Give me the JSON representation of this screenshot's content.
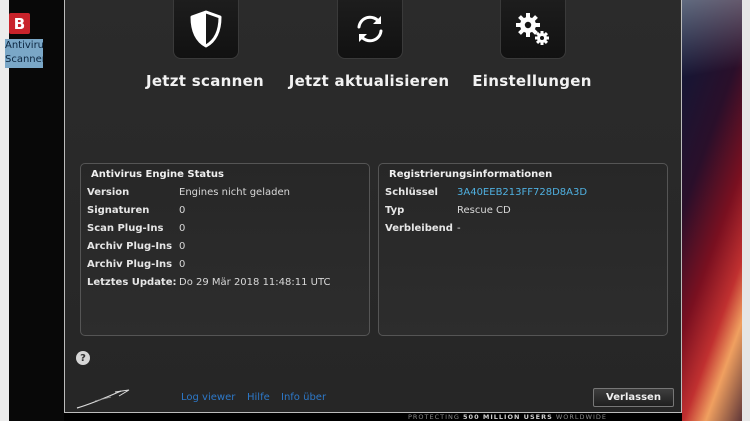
{
  "desktop": {
    "icon_letter": "B",
    "icon_label": "Antivirus Scanner"
  },
  "actions": [
    {
      "label": "Jetzt scannen",
      "icon": "shield-icon"
    },
    {
      "label": "Jetzt aktualisieren",
      "icon": "refresh-icon"
    },
    {
      "label": "Einstellungen",
      "icon": "gears-icon"
    }
  ],
  "engine_status": {
    "title": "Antivirus Engine Status",
    "rows": [
      {
        "key": "Version",
        "value": "Engines nicht geladen"
      },
      {
        "key": "Signaturen",
        "value": "0"
      },
      {
        "key": "Scan Plug-Ins",
        "value": "0"
      },
      {
        "key": "Archiv Plug-Ins",
        "value": "0"
      },
      {
        "key": "Archiv Plug-Ins",
        "value": "0"
      },
      {
        "key": "Letztes Update:",
        "value": "Do 29 Mär 2018 11:48:11 UTC"
      }
    ]
  },
  "registration": {
    "title": "Registrierungsinformationen",
    "rows": [
      {
        "key": "Schlüssel",
        "value": "3A40EEB213FF728D8A3D"
      },
      {
        "key": "Typ",
        "value": "Rescue CD"
      },
      {
        "key": "Verbleibend",
        "value": "-"
      }
    ]
  },
  "footer": {
    "help": "?",
    "links": [
      "Log viewer",
      "Hilfe",
      "Info über"
    ],
    "exit_label": "Verlassen",
    "tagline_pre": "PROTECTING ",
    "tagline_bold": "500 MILLION USERS",
    "tagline_post": " WORLDWIDE"
  },
  "colors": {
    "link": "#4fb0e0",
    "footer_link": "#2d78c8",
    "window_bg": "#2b2b2b"
  }
}
